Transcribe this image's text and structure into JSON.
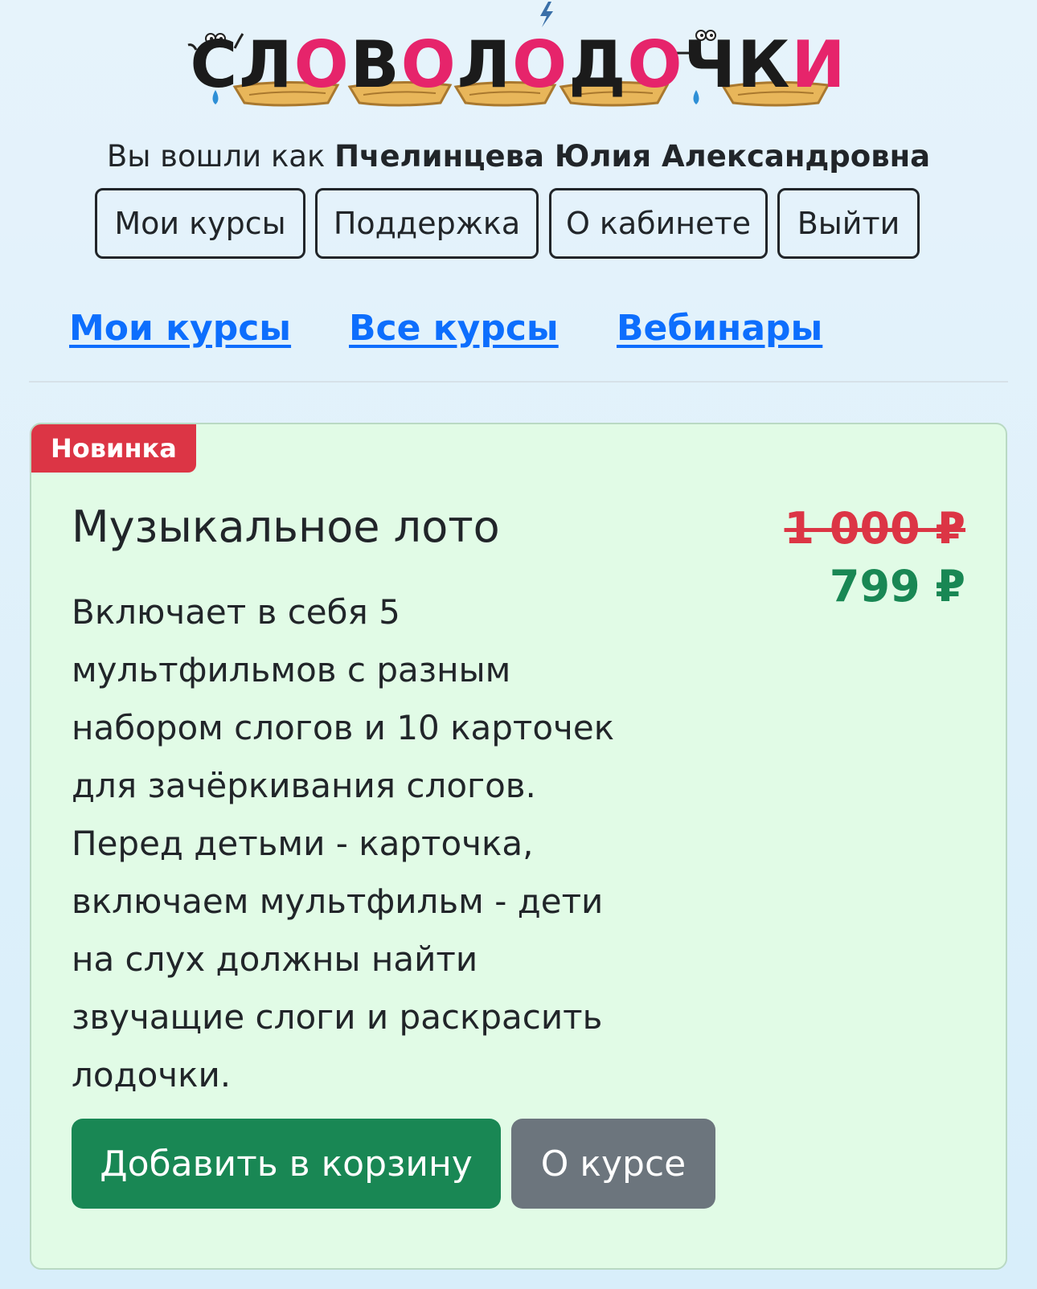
{
  "logo": {
    "text_parts": [
      {
        "text": "С",
        "color": "#1b1b1b"
      },
      {
        "text": "Л",
        "color": "#1b1b1b"
      },
      {
        "text": "О",
        "color": "#e6246b"
      },
      {
        "text": "В",
        "color": "#1b1b1b"
      },
      {
        "text": "О",
        "color": "#e6246b"
      },
      {
        "text": "Л",
        "color": "#1b1b1b"
      },
      {
        "text": "О",
        "color": "#e6246b"
      },
      {
        "text": "Д",
        "color": "#1b1b1b"
      },
      {
        "text": "О",
        "color": "#e6246b"
      },
      {
        "text": "Ч",
        "color": "#1b1b1b"
      },
      {
        "text": "К",
        "color": "#1b1b1b"
      },
      {
        "text": "И",
        "color": "#e6246b"
      }
    ],
    "full_text": "СЛОВОЛОДОЧКИ"
  },
  "header": {
    "logged_in_prefix": "Вы вошли как",
    "user_name": "Пчелинцева Юлия Александровна",
    "buttons": {
      "my_courses": "Мои курсы",
      "support": "Поддержка",
      "about_cabinet": "О кабинете",
      "logout": "Выйти"
    }
  },
  "nav": {
    "my_courses": "Мои курсы",
    "all_courses": "Все курсы",
    "webinars": "Вебинары"
  },
  "card": {
    "badge": "Новинка",
    "title": "Музыкальное лото",
    "price_old": "1 000 ₽",
    "price_new": "799 ₽",
    "description_lines": [
      "Включает в себя 5",
      "мультфильмов с разным",
      "набором слогов и 10 карточек",
      "для зачёркивания слогов.",
      "Перед детьми - карточка,",
      "включаем мультфильм - дети",
      "на слух должны найти",
      "звучащие слоги и раскрасить",
      "лодочки."
    ],
    "add_to_cart": "Добавить в корзину",
    "about_course": "О курсе"
  },
  "colors": {
    "accent_pink": "#e6246b",
    "link_blue": "#0d6efd",
    "success_green": "#198754",
    "danger_red": "#dc3545",
    "secondary_gray": "#6c757d",
    "card_bg": "#e1fbe6"
  }
}
